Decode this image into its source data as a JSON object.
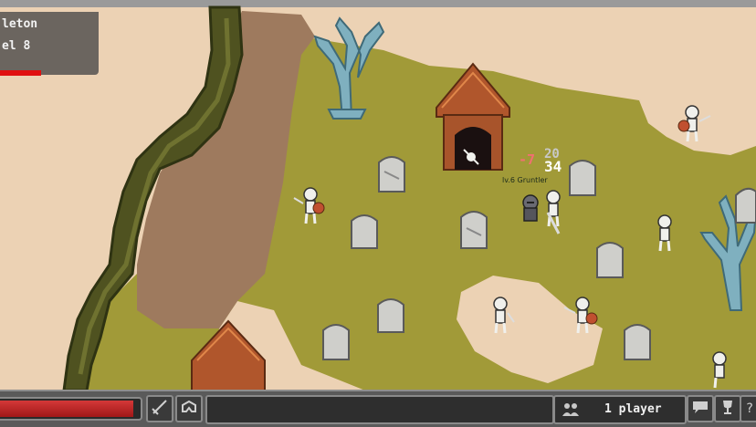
{
  "target": {
    "name": "leton",
    "level": "el 8",
    "hp_fraction": 0.42
  },
  "player_overhead": {
    "nameplate": "lv.6 Gruntler",
    "damage_dealt": "-7",
    "hp_numbers": [
      "20",
      "34"
    ]
  },
  "bottom_bar": {
    "player_hp_fraction": 0.97,
    "players_label": "1 player",
    "buttons": [
      {
        "icon": "sword-icon"
      },
      {
        "icon": "armor-icon"
      },
      {
        "icon": "chat-icon"
      },
      {
        "icon": "trophy-icon"
      },
      {
        "icon": "help-icon",
        "glyph": "?"
      }
    ],
    "players_icon": "population-icon"
  },
  "colors": {
    "grass": "#a19a38",
    "sand": "#ecd2b4",
    "dirt": "#9e7a5e",
    "cliff": "#4f5220",
    "hp_red": "#e01010",
    "bone": "#f0f0ec",
    "stone": "#cfcfcb",
    "roof": "#b0562c",
    "tree": "#7fb0bf"
  }
}
